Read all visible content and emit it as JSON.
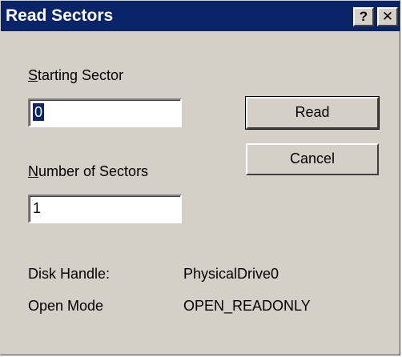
{
  "window": {
    "title": "Read Sectors",
    "help_glyph": "?",
    "close_glyph": "✕"
  },
  "fields": {
    "starting_sector": {
      "label_accel": "S",
      "label_rest": "tarting Sector",
      "value": "0"
    },
    "number_of_sectors": {
      "label_accel": "N",
      "label_rest": "umber of Sectors",
      "value": "1"
    }
  },
  "buttons": {
    "read": "Read",
    "cancel": "Cancel"
  },
  "info": {
    "disk_handle_label": "Disk Handle:",
    "disk_handle_value": "PhysicalDrive0",
    "open_mode_label": "Open Mode",
    "open_mode_value": "OPEN_READONLY"
  },
  "colors": {
    "titlebar": "#0a246a",
    "face": "#d4d0c8",
    "selection": "#0a246a"
  }
}
